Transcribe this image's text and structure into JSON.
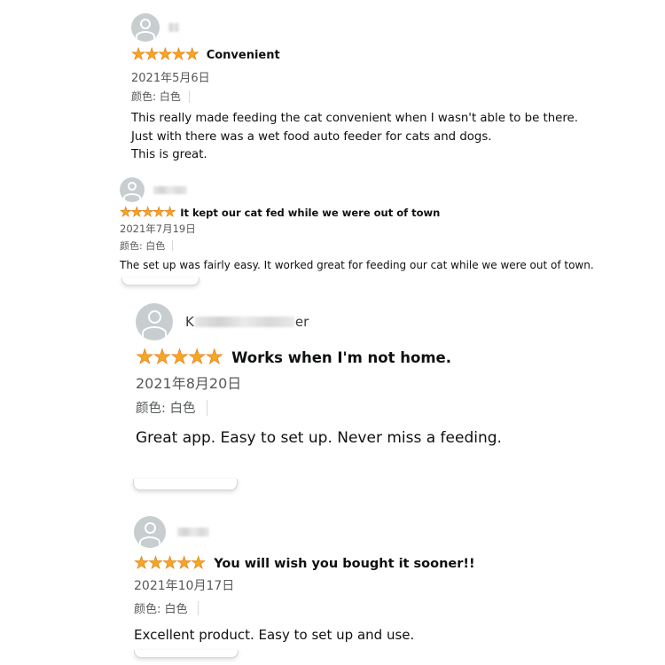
{
  "colors": {
    "star": "#f5a623",
    "star_outline": "#e47911",
    "text": "#0f1111",
    "meta_text": "#565959",
    "avatar_bg": "#c8cdd0"
  },
  "icons": {
    "avatar": "default-user-avatar-icon",
    "star": "filled-star-icon"
  },
  "reviews": [
    {
      "reviewer_name_visible": "",
      "reviewer_name_end": "",
      "rating": 5,
      "title": "Convenient",
      "date": "2021年5月6日",
      "attribute": "颜色: 白色",
      "body_lines": [
        "This really made feeding the cat convenient when I wasn't able to be there.",
        "Just with there was a wet food auto feeder for cats and dogs.",
        "This is great."
      ]
    },
    {
      "reviewer_name_visible": "",
      "reviewer_name_end": "",
      "rating": 5,
      "title": "It kept our cat fed while we were out of town",
      "date": "2021年7月19日",
      "attribute": "颜色: 白色",
      "body_lines": [
        "The set up was fairly easy. It worked great for feeding our cat while we were out of town."
      ]
    },
    {
      "reviewer_name_visible": "K",
      "reviewer_name_end": "er",
      "rating": 5,
      "title": "Works when I'm not home.",
      "date": "2021年8月20日",
      "attribute": "颜色: 白色",
      "body_lines": [
        "Great app. Easy to set up. Never miss a feeding."
      ]
    },
    {
      "reviewer_name_visible": "",
      "reviewer_name_end": "",
      "rating": 5,
      "title": "You will wish you bought it sooner!!",
      "date": "2021年10月17日",
      "attribute": "颜色: 白色",
      "body_lines": [
        "Excellent product. Easy to set up and use."
      ]
    }
  ]
}
